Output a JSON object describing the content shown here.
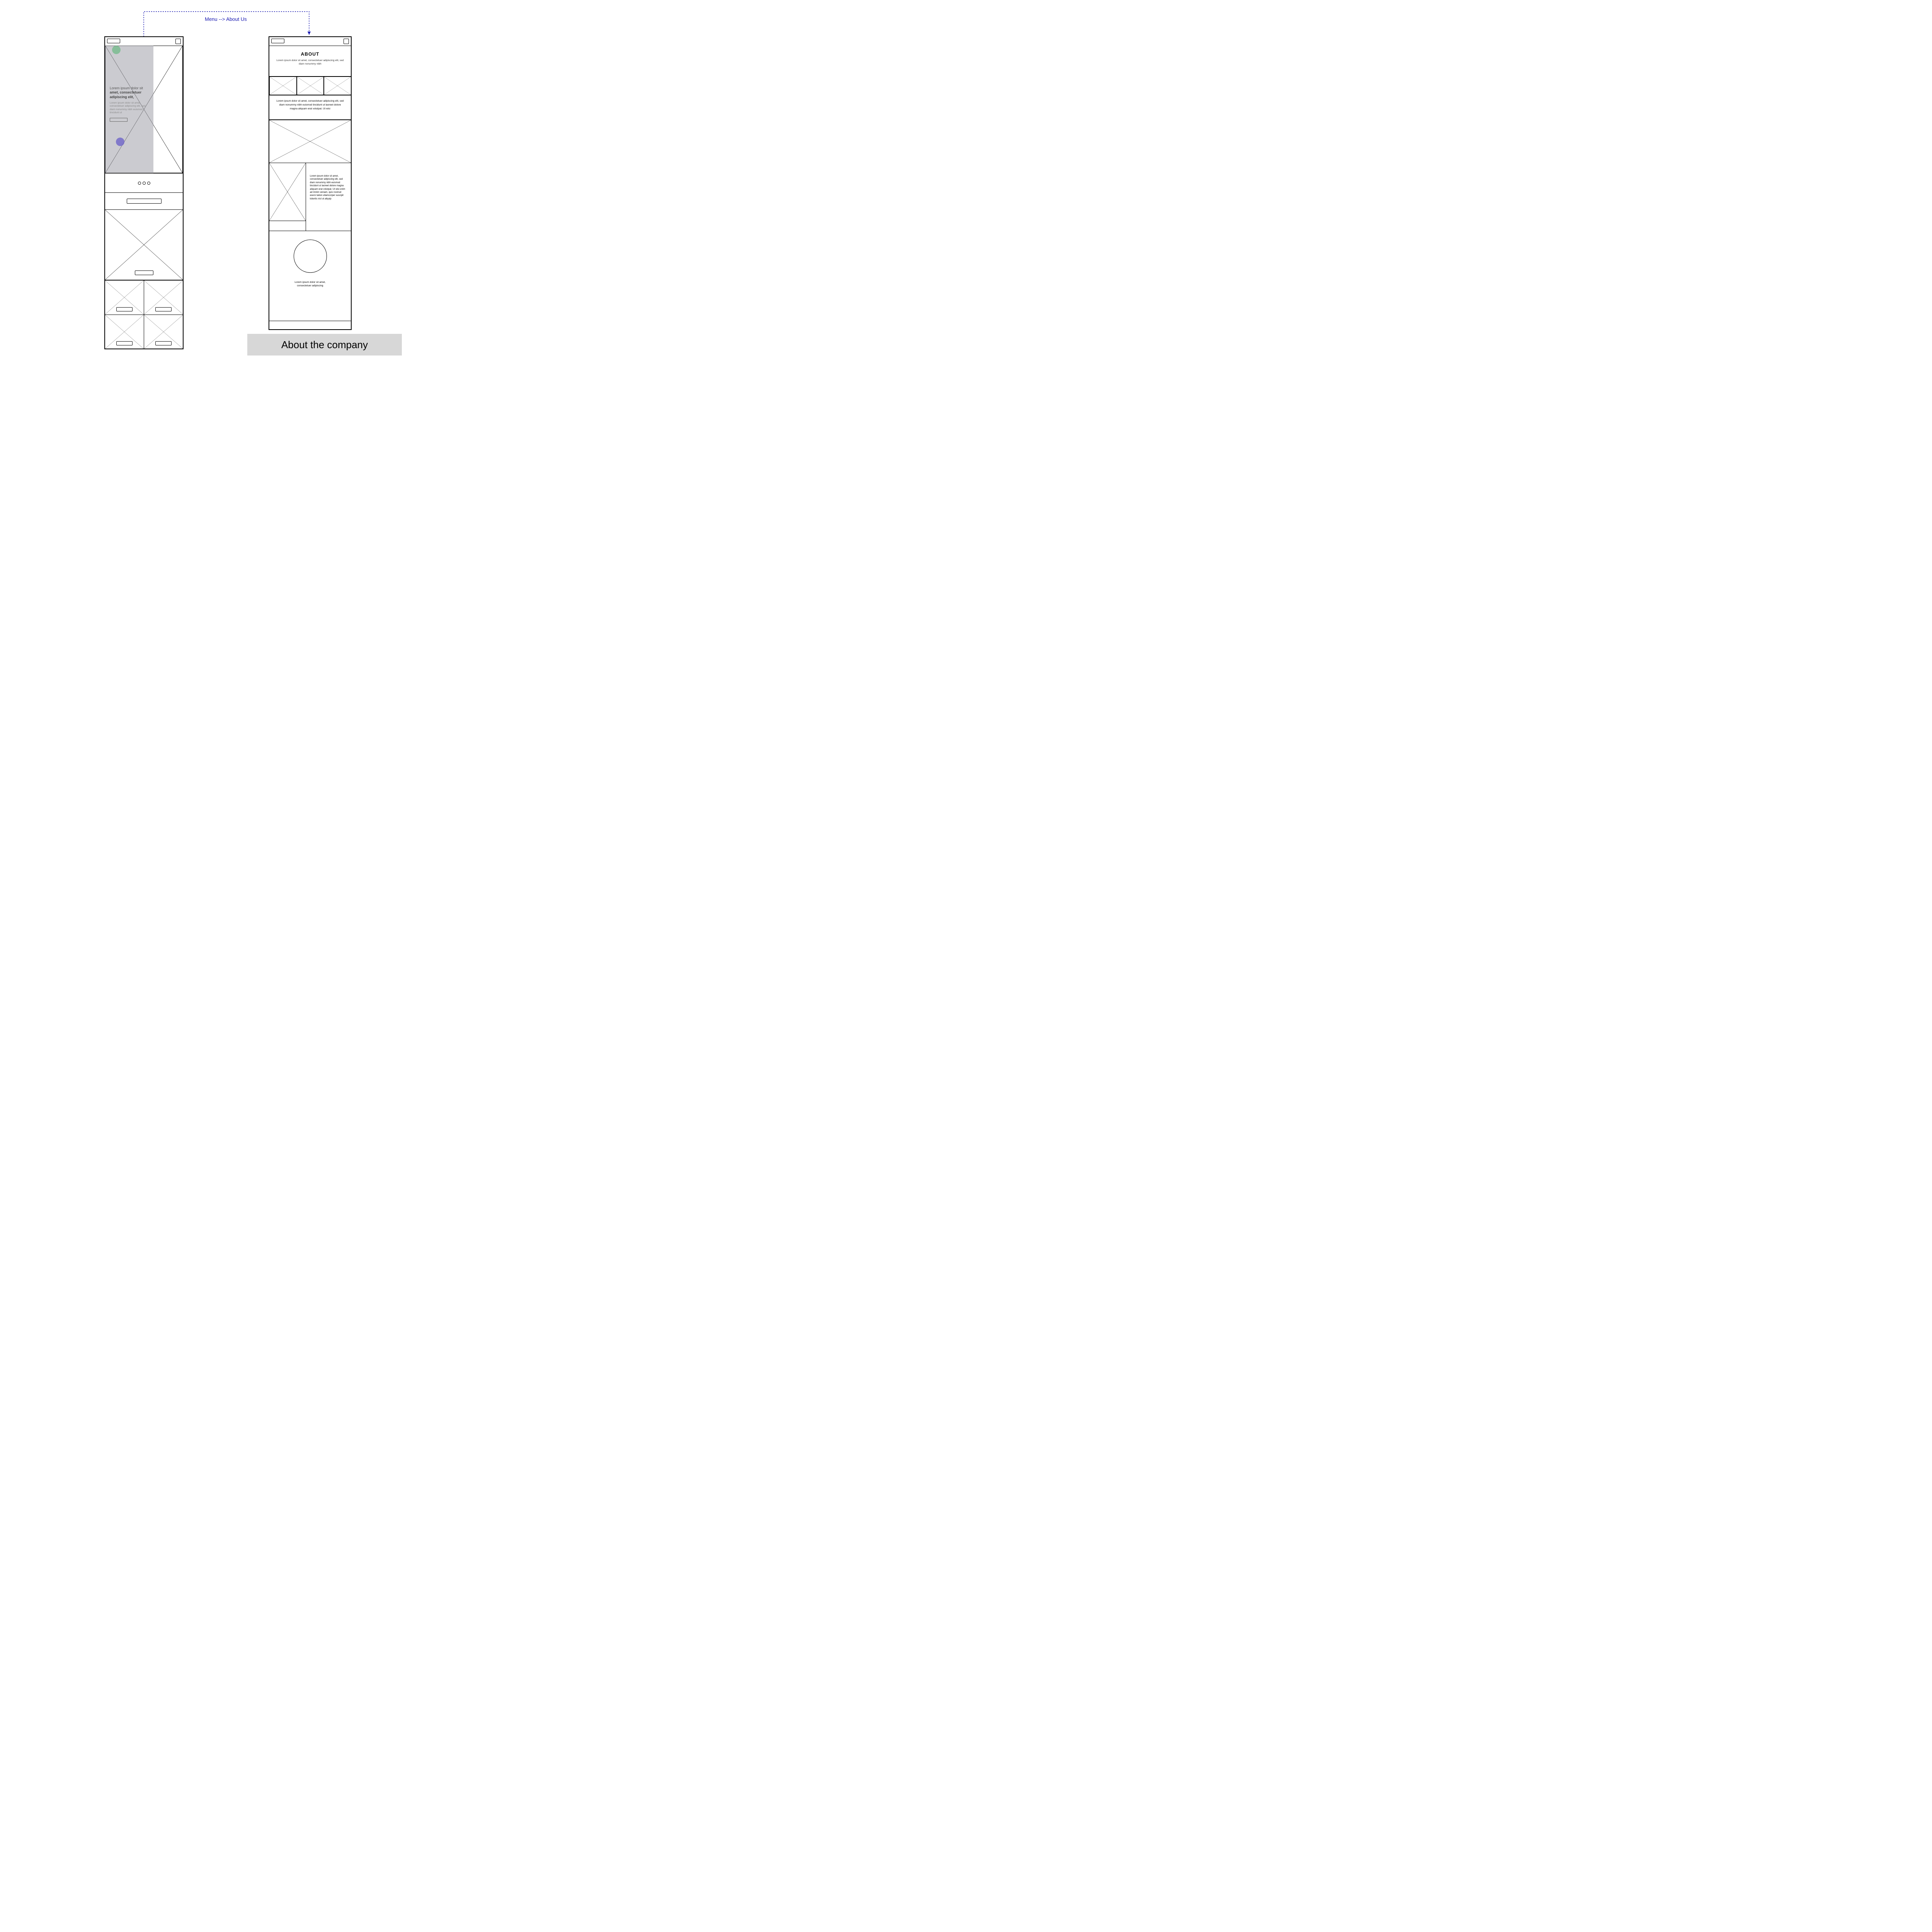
{
  "flow": {
    "label": "Menu --> About Us"
  },
  "leftFrame": {
    "hero": {
      "title_plain": "Lorem ipsum dolor sit ",
      "title_bold": "amet, consectetuer adipiscing elit,",
      "body": "Lorem ipsum dolor sit amet, consectetuer adipiscing elit, sed diam nonummy nibh euismod tincidunt ut"
    }
  },
  "rightFrame": {
    "about": {
      "heading": "ABOUT",
      "intro": "Lorem ipsum dolor sit amet, consectetuer adipiscing elit, sed diam nonummy nibh"
    },
    "desc1": "Lorem ipsum dolor sit amet, consectetuer adipiscing elit, sed diam nonummy nibh euismod tincidunt ut laoreet dolore magna aliquam erat volutpat. Ut wisi",
    "split_text": "Lorem ipsum dolor sit amet, consectetuer adipiscing elit, sed diam nonummy nibh euismod tincidunt ut laoreet dolore magna aliquam erat volutpat. Ut wisi enim ad minim veniam, quis nostrud exerci tation ullamcorper suscipit lobortis nisl ut aliquip",
    "circle_caption": "Lorem ipsum dolor sit amet, consectetuer adipiscing"
  },
  "caption": "About the company",
  "colors": {
    "flow_arrow": "#1a1ab2",
    "overlay": "rgba(160,160,170,0.55)",
    "dot_green": "rgba(80,180,110,0.55)",
    "dot_purple": "rgba(110,100,200,0.8)",
    "caption_bg": "#d7d7d7"
  }
}
